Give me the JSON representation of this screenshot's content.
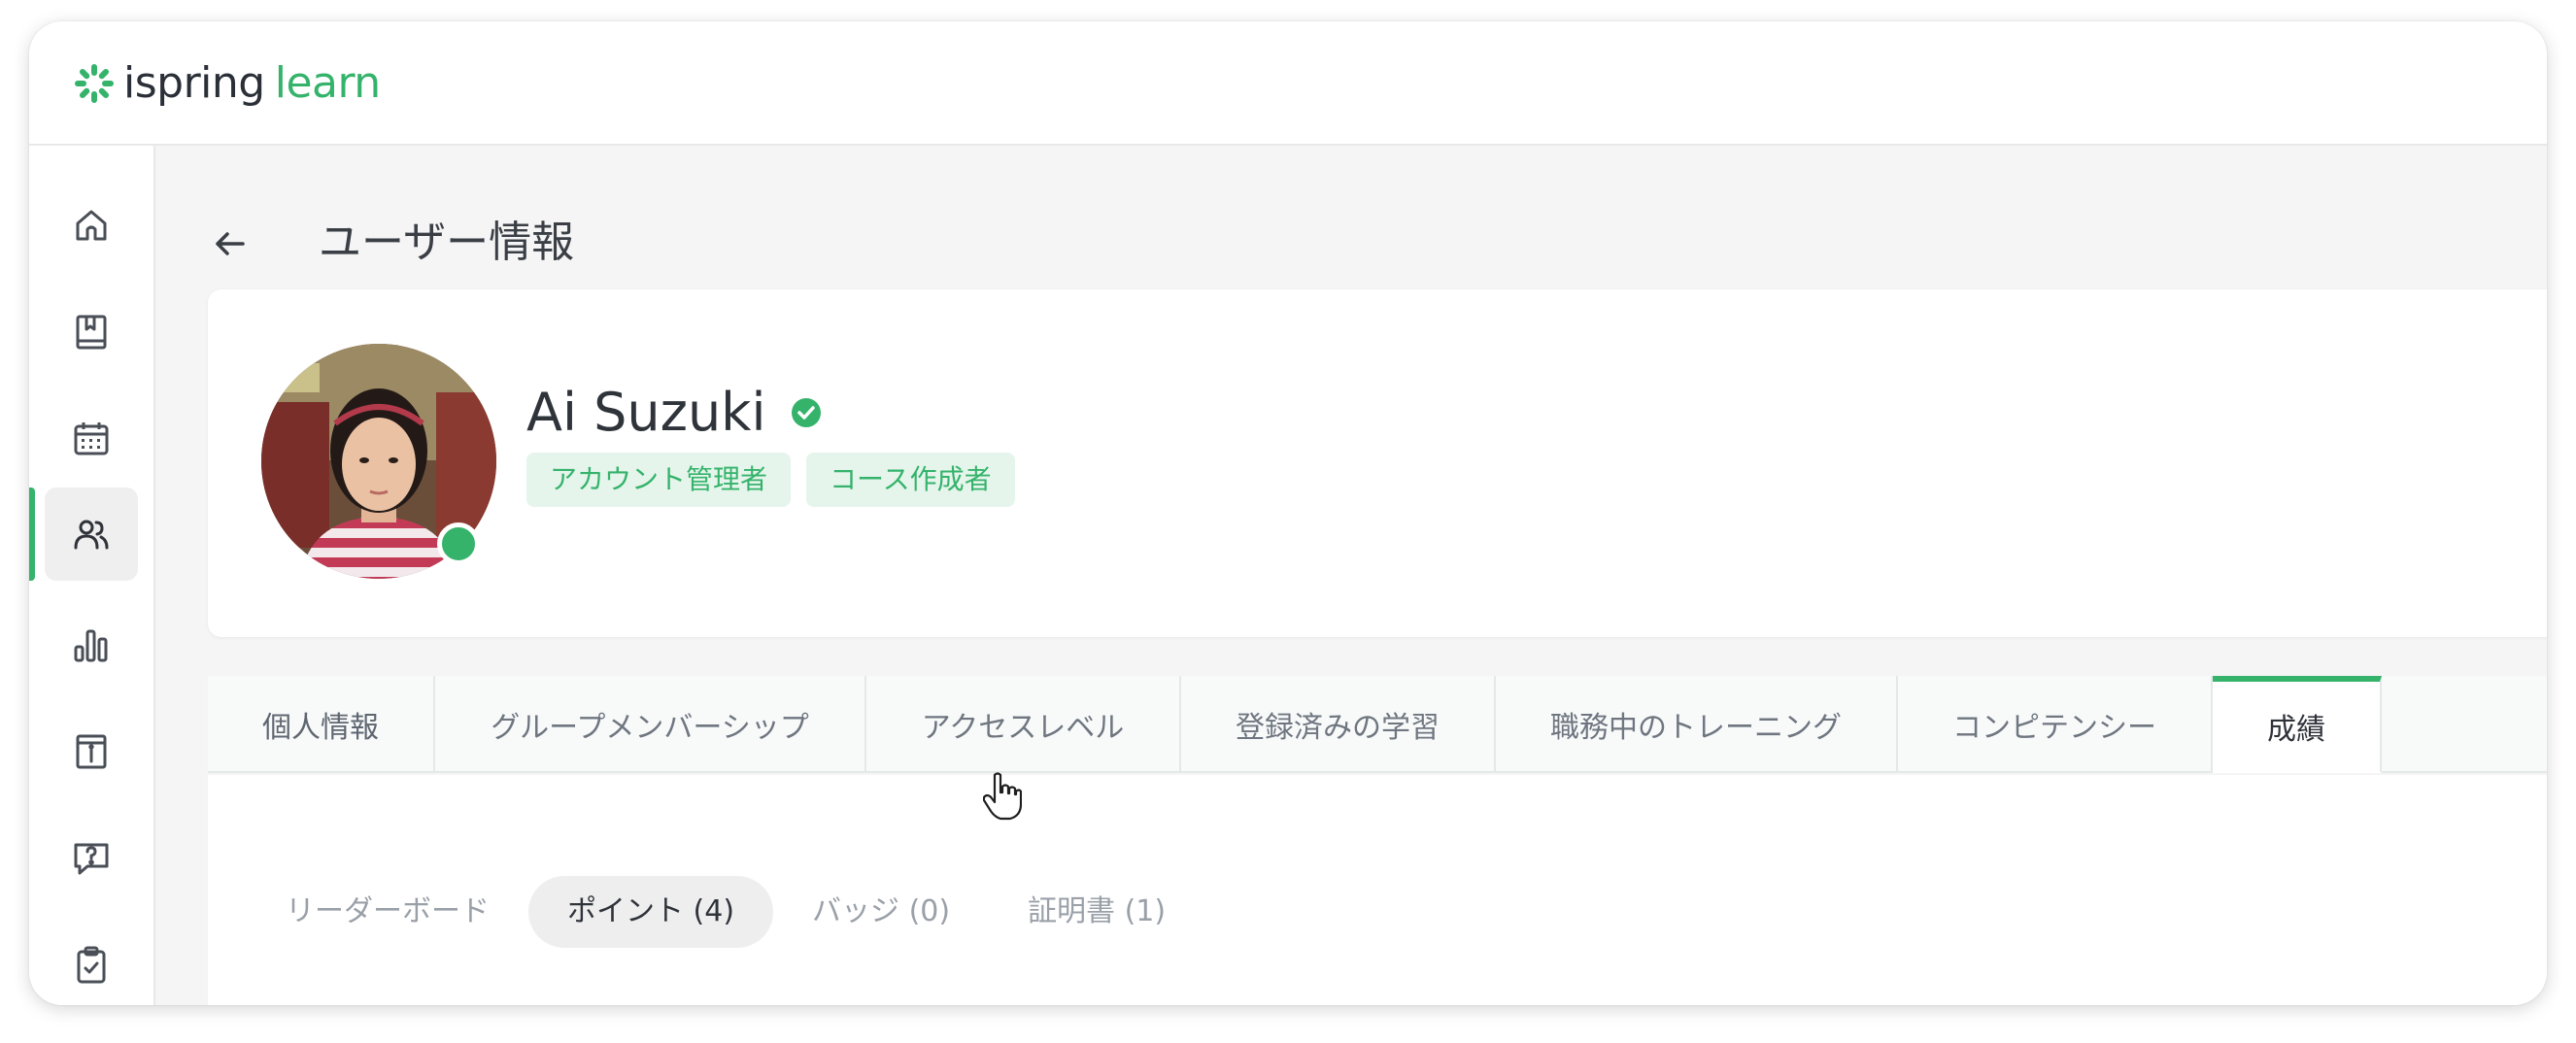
{
  "app": {
    "logo_primary": "ispring",
    "logo_secondary": "learn",
    "brand_color": "#35b36b"
  },
  "sidebar": {
    "items": [
      {
        "icon": "home-icon"
      },
      {
        "icon": "book-icon"
      },
      {
        "icon": "calendar-icon"
      },
      {
        "icon": "users-icon",
        "active": true
      },
      {
        "icon": "bar-chart-icon"
      },
      {
        "icon": "info-board-icon"
      },
      {
        "icon": "help-chat-icon"
      },
      {
        "icon": "clipboard-check-icon"
      }
    ]
  },
  "page": {
    "title": "ユーザー情報",
    "back_icon": "arrow-left-icon"
  },
  "profile": {
    "name": "Ai Suzuki",
    "verified_icon": "check-circle-icon",
    "status": "online",
    "roles": [
      "アカウント管理者",
      "コース作成者"
    ]
  },
  "tabs": [
    {
      "label": "個人情報"
    },
    {
      "label": "グループメンバーシップ"
    },
    {
      "label": "アクセスレベル"
    },
    {
      "label": "登録済みの学習"
    },
    {
      "label": "職務中のトレーニング"
    },
    {
      "label": "コンピテンシー"
    },
    {
      "label": "成績",
      "active": true
    }
  ],
  "subtabs": [
    {
      "label": "リーダーボード"
    },
    {
      "label": "ポイント (4)",
      "active": true
    },
    {
      "label": "バッジ (0)"
    },
    {
      "label": "証明書 (1)"
    }
  ]
}
